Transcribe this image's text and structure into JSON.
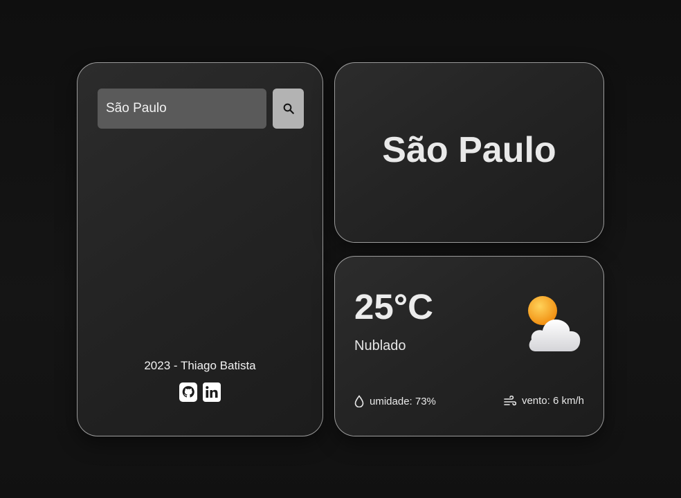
{
  "search": {
    "value": "São Paulo",
    "placeholder": "",
    "button_icon": "search-icon"
  },
  "footer": {
    "text": "2023 - Thiago Batista",
    "social": [
      {
        "icon": "github-icon"
      },
      {
        "icon": "linkedin-icon"
      }
    ]
  },
  "city": {
    "name": "São Paulo"
  },
  "weather": {
    "temperature": "25°C",
    "description": "Nublado",
    "icon": "partly-cloudy-icon",
    "humidity_label": "umidade: 73%",
    "humidity_icon": "droplet-icon",
    "wind_label": "vento: 6 km/h",
    "wind_icon": "wind-icon"
  },
  "colors": {
    "background": "#111111",
    "card": "#262626",
    "input": "#5a5a5a",
    "button": "#b3b3b3",
    "sun": "#f4a818",
    "cloud": "#f2f2f2"
  }
}
